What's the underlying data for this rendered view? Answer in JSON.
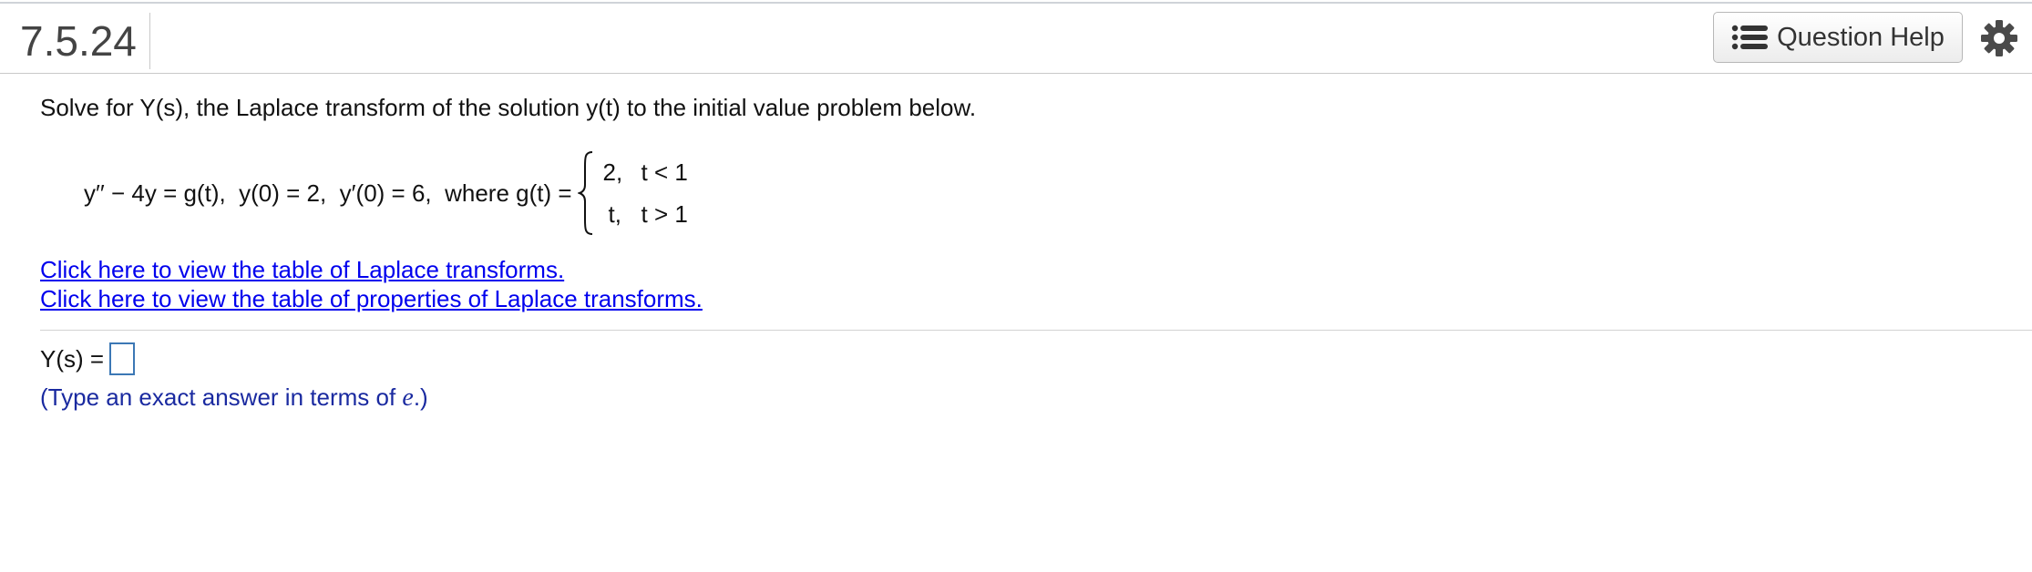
{
  "header": {
    "question_number": "7.5.24",
    "help_label": "Question Help",
    "help_icon": "list-icon",
    "settings_icon": "gear-icon"
  },
  "problem": {
    "prompt": "Solve for Y(s), the Laplace transform of the solution y(t) to the initial value problem below.",
    "equation_lhs": "y′′ − 4y = g(t),  y(0) = 2,  y′(0) = 6,  where g(t) =",
    "cases": [
      {
        "value": "2,",
        "condition": "t < 1"
      },
      {
        "value": "t,",
        "condition": "t > 1"
      }
    ]
  },
  "links": {
    "laplace_table": "Click here to view the table of Laplace transforms.",
    "properties_table": "Click here to view the table of properties of Laplace transforms."
  },
  "answer": {
    "label": "Y(s) =",
    "hint_prefix": "(Type an exact answer in terms of ",
    "hint_var": "e",
    "hint_suffix": ".)"
  },
  "colors": {
    "link": "#0000ee",
    "hint": "#1a2aa0",
    "answer_box_border": "#3c78b5"
  }
}
